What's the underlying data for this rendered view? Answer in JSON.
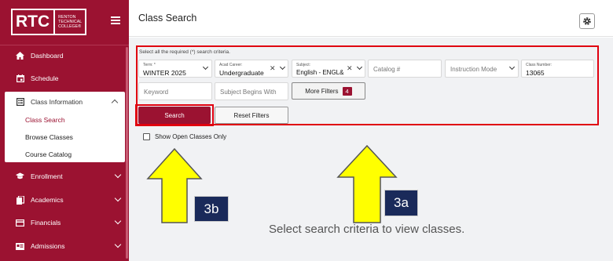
{
  "logo": {
    "mark": "RTC",
    "line1": "RENTON",
    "line2": "TECHNICAL",
    "line3": "COLLEGE®"
  },
  "sidebar": {
    "items": [
      {
        "label": "Dashboard"
      },
      {
        "label": "Schedule"
      },
      {
        "label": "Class Information"
      },
      {
        "label": "Enrollment"
      },
      {
        "label": "Academics"
      },
      {
        "label": "Financials"
      },
      {
        "label": "Admissions"
      }
    ],
    "submenu": [
      "Class Search",
      "Browse Classes",
      "Course Catalog"
    ]
  },
  "header": {
    "title": "Class Search"
  },
  "search": {
    "hint": "Select all the required (*) search criteria.",
    "term": {
      "label": "Term: *",
      "value": "WINTER 2025"
    },
    "career": {
      "label": "Acad Career:",
      "value": "Undergraduate"
    },
    "subject": {
      "label": "Subject:",
      "value": "English - ENGL&"
    },
    "catalog": {
      "placeholder": "Catalog #"
    },
    "mode": {
      "placeholder": "Instruction Mode"
    },
    "class_number": {
      "label": "Class Number:",
      "value": "13065"
    },
    "keyword": {
      "placeholder": "Keyword"
    },
    "subject_begins": {
      "placeholder": "Subject Begins With"
    },
    "more_filters": {
      "label": "More Filters",
      "count": "4"
    },
    "search_label": "Search",
    "reset_label": "Reset Filters",
    "open_only_label": "Show Open Classes Only"
  },
  "callouts": {
    "a": "3a",
    "b": "3b"
  },
  "empty_message": "Select search criteria to view classes.",
  "colors": {
    "brand": "#9b1231",
    "highlight": "#e0000f",
    "arrow": "#ffff00",
    "callout": "#1a2a5a"
  }
}
